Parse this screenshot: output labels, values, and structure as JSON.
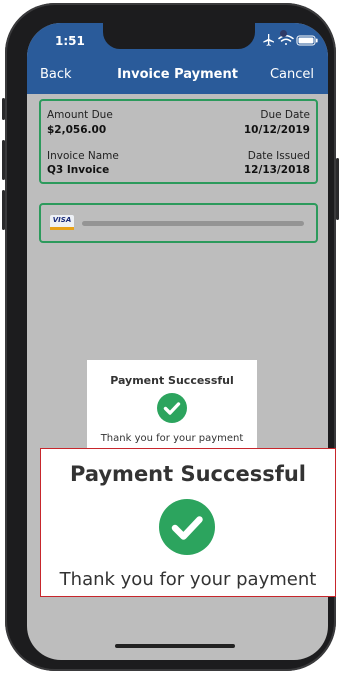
{
  "status_bar": {
    "time": "1:51"
  },
  "nav": {
    "back_label": "Back",
    "title": "Invoice Payment",
    "cancel_label": "Cancel"
  },
  "invoice": {
    "amount_due_label": "Amount Due",
    "amount_due_value": "$2,056.00",
    "due_date_label": "Due Date",
    "due_date_value": "10/12/2019",
    "invoice_name_label": "Invoice Name",
    "invoice_name_value": "Q3 Invoice",
    "date_issued_label": "Date Issued",
    "date_issued_value": "12/13/2018"
  },
  "payment_method": {
    "card_brand": "VISA"
  },
  "dialog": {
    "title": "Payment Successful",
    "message": "Thank you for your payment",
    "icon": "check-circle-icon"
  },
  "colors": {
    "header": "#2a5b9a",
    "accent_green": "#2c9a5c",
    "success_green": "#2ca45e",
    "callout_border": "#c7262c"
  }
}
